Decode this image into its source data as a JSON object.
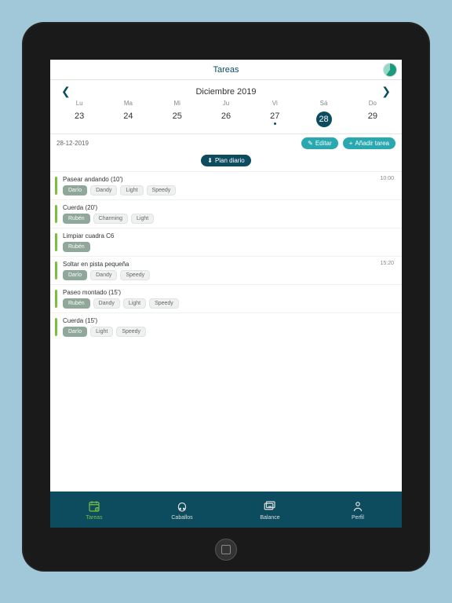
{
  "header": {
    "title": "Tareas"
  },
  "calendar": {
    "month_label": "Diciembre 2019",
    "days": [
      {
        "abbr": "Lu",
        "num": "23",
        "selected": false,
        "dot": false
      },
      {
        "abbr": "Ma",
        "num": "24",
        "selected": false,
        "dot": false
      },
      {
        "abbr": "Mi",
        "num": "25",
        "selected": false,
        "dot": false
      },
      {
        "abbr": "Ju",
        "num": "26",
        "selected": false,
        "dot": false
      },
      {
        "abbr": "Vi",
        "num": "27",
        "selected": false,
        "dot": true
      },
      {
        "abbr": "Sá",
        "num": "28",
        "selected": true,
        "dot": false
      },
      {
        "abbr": "Do",
        "num": "29",
        "selected": false,
        "dot": false
      }
    ]
  },
  "selected_date": "28-12-2019",
  "actions": {
    "edit": "Editar",
    "add": "Añadir tarea",
    "plan": "Plan diario"
  },
  "tasks": [
    {
      "title": "Pasear andando (10')",
      "time": "10:00",
      "tags": [
        "Darío",
        "Dandy",
        "Light",
        "Speedy"
      ],
      "active": 0
    },
    {
      "title": "Cuerda (20')",
      "time": "",
      "tags": [
        "Rubén",
        "Charming",
        "Light"
      ],
      "active": 0
    },
    {
      "title": "Limpiar cuadra C6",
      "time": "",
      "tags": [
        "Rubén"
      ],
      "active": 0
    },
    {
      "title": "Soltar en pista pequeña",
      "time": "15:20",
      "tags": [
        "Darío",
        "Dandy",
        "Speedy"
      ],
      "active": 0
    },
    {
      "title": "Paseo montado (15')",
      "time": "",
      "tags": [
        "Rubén",
        "Dandy",
        "Light",
        "Speedy"
      ],
      "active": 0
    },
    {
      "title": "Cuerda (15')",
      "time": "",
      "tags": [
        "Darío",
        "Light",
        "Speedy"
      ],
      "active": 0
    }
  ],
  "nav": [
    {
      "label": "Tareas",
      "active": true
    },
    {
      "label": "Caballos",
      "active": false
    },
    {
      "label": "Balance",
      "active": false
    },
    {
      "label": "Perfil",
      "active": false
    }
  ]
}
